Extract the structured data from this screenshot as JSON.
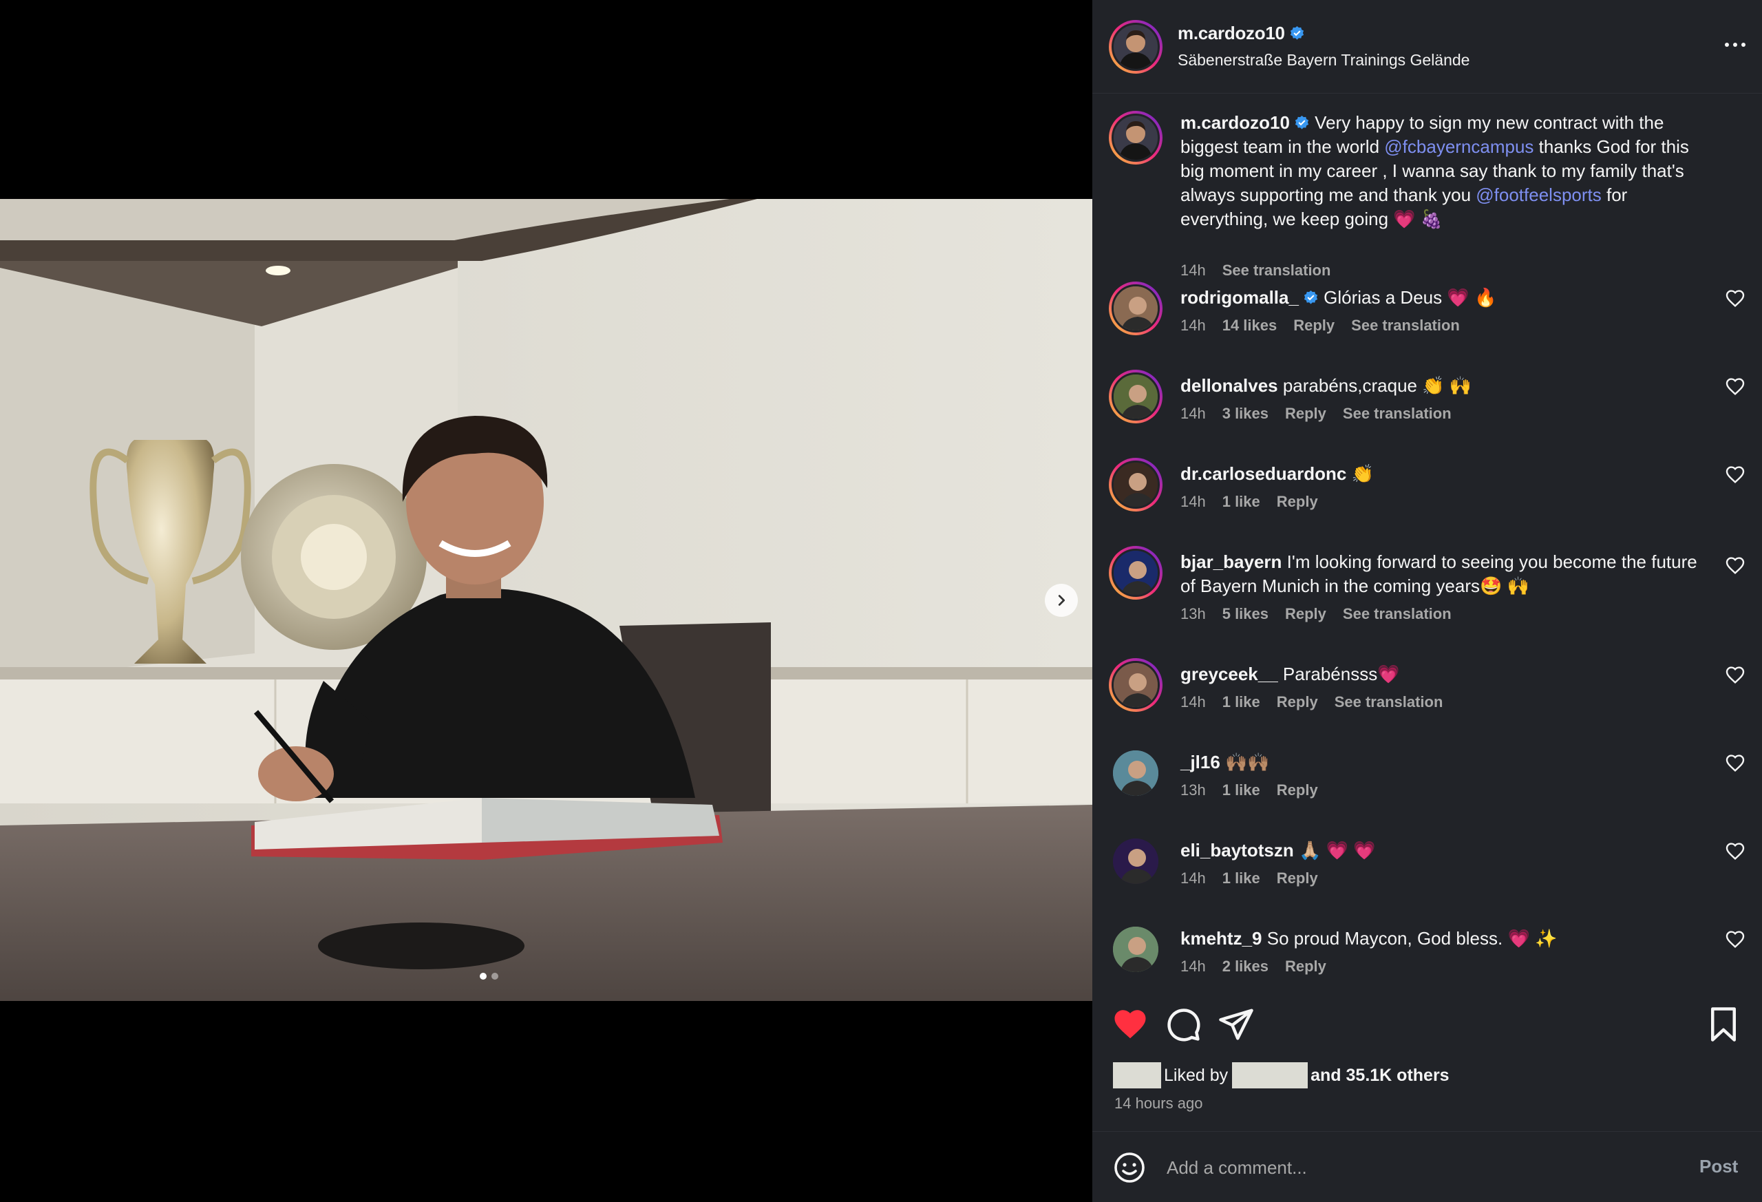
{
  "post": {
    "username": "m.cardozo10",
    "location": "Säbenerstraße Bayern Trainings Gelände",
    "caption": {
      "part1": " Very happy to sign my new contract with the biggest team in the world ",
      "mention1": "@fcbayerncampus",
      "part2": " thanks God for this big moment in my career , I wanna say thank to my family that's always supporting me and thank you ",
      "mention2": "@footfeelsports",
      "part3": " for everything, we keep going 💗 🍇",
      "time": "14h",
      "see_translation": "See translation"
    },
    "likes_prefix": "Liked by",
    "likes_suffix": "and 35.1K others",
    "time_ago": "14 hours ago"
  },
  "comments": [
    {
      "username": "rodrigomalla_",
      "verified": true,
      "text": " Glórias a Deus 💗 🔥",
      "time": "14h",
      "likes": "14 likes",
      "reply": "Reply",
      "translation": "See translation"
    },
    {
      "username": "dellonalves",
      "verified": false,
      "text": " parabéns,craque 👏 🙌",
      "time": "14h",
      "likes": "3 likes",
      "reply": "Reply",
      "translation": "See translation"
    },
    {
      "username": "dr.carloseduardonc",
      "verified": false,
      "text": " 👏",
      "time": "14h",
      "likes": "1 like",
      "reply": "Reply",
      "translation": ""
    },
    {
      "username": "bjar_bayern",
      "verified": false,
      "text": " I'm looking forward to seeing you become the future of Bayern Munich in the coming years🤩 🙌",
      "time": "13h",
      "likes": "5 likes",
      "reply": "Reply",
      "translation": "See translation"
    },
    {
      "username": "greyceek__",
      "verified": false,
      "text": " Parabénsss💗",
      "time": "14h",
      "likes": "1 like",
      "reply": "Reply",
      "translation": "See translation"
    },
    {
      "username": "_jl16",
      "verified": false,
      "text": " 🙌🏽🙌🏽",
      "time": "13h",
      "likes": "1 like",
      "reply": "Reply",
      "translation": ""
    },
    {
      "username": "eli_baytotszn",
      "verified": false,
      "text": " 🙏🏼 💗 💗",
      "time": "14h",
      "likes": "1 like",
      "reply": "Reply",
      "translation": ""
    },
    {
      "username": "kmehtz_9",
      "verified": false,
      "text": " So proud Maycon, God bless. 💗 ✨",
      "time": "14h",
      "likes": "2 likes",
      "reply": "Reply",
      "translation": ""
    }
  ],
  "composer": {
    "placeholder": "Add a comment...",
    "post_label": "Post"
  },
  "colors": {
    "panel_bg": "#212328",
    "mention": "#7e8ff0",
    "like_red": "#ff3040",
    "verified_blue": "#3897f0"
  },
  "icons": [
    "chevron-right-icon",
    "more-icon",
    "verified-icon",
    "heart-icon",
    "heart-filled-icon",
    "comment-icon",
    "share-icon",
    "bookmark-icon",
    "emoji-icon"
  ]
}
